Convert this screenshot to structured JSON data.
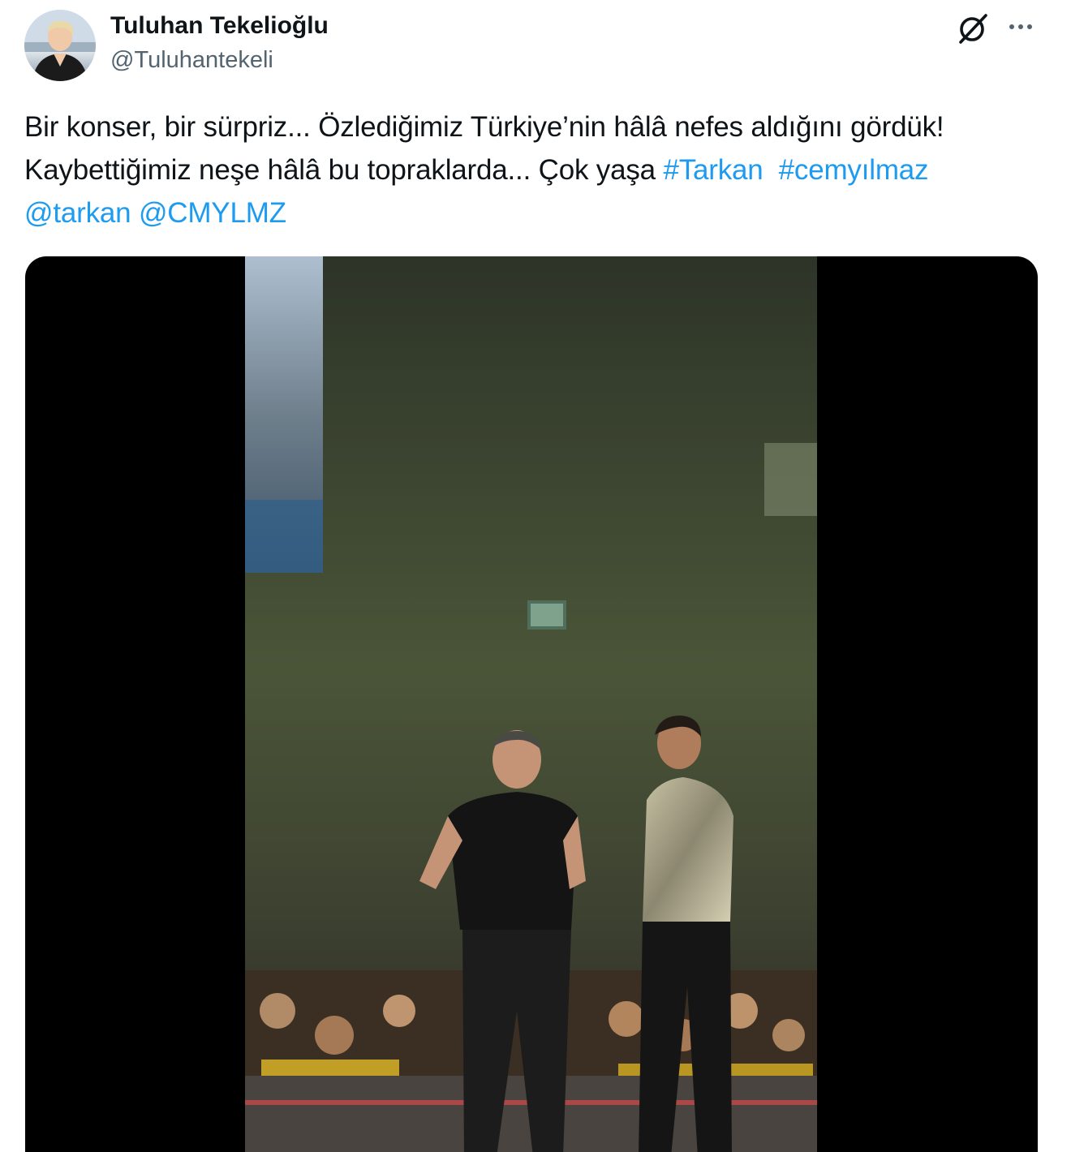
{
  "tweet": {
    "author": {
      "display_name": "Tuluhan Tekelioğlu",
      "handle": "@Tuluhantekeli"
    },
    "header_icons": [
      "grok-icon",
      "more-icon"
    ],
    "text": {
      "line1": "Bir konser, bir sürpriz... Özlediğimiz Türkiye’nin hâlâ nefes aldığını gördük!",
      "line2_plain": "Kaybettiğimiz neşe hâlâ bu topraklarda... Çok yaşa ",
      "hashtag_1": "#Tarkan",
      "hashtag_2": "#cemyılmaz",
      "mention_1": "@tarkan",
      "mention_2": "@CMYLMZ"
    },
    "media": {
      "type": "video"
    }
  },
  "colors": {
    "link": "#1d9bf0",
    "text": "#0f1419",
    "secondary_text": "#536471",
    "media_background": "#000000"
  }
}
